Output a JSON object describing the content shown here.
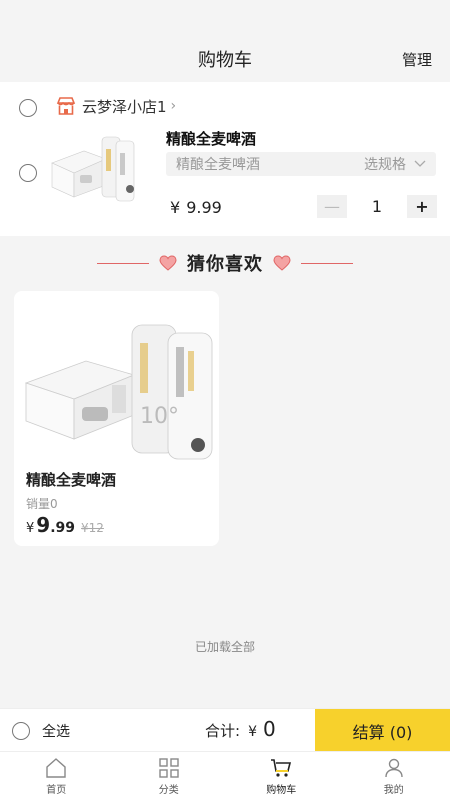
{
  "header": {
    "title": "购物车",
    "manage": "管理"
  },
  "cart": {
    "shop_name": "云梦泽小店1",
    "item": {
      "title": "精酿全麦啤酒",
      "spec": "精酿全麦啤酒",
      "spec_select": "选规格",
      "currency": "¥",
      "price": "9.99",
      "quantity": "1",
      "minus": "—",
      "plus": "+"
    }
  },
  "recommend": {
    "title": "猜你喜欢",
    "product": {
      "name": "精酿全麦啤酒",
      "sales": "销量0",
      "currency": "¥",
      "price_int": "9",
      "price_dec": ".99",
      "original_price": "¥12"
    }
  },
  "loaded_all": "已加载全部",
  "checkout": {
    "select_all": "全选",
    "total_label": "合计:",
    "currency": "¥",
    "total": "0",
    "pay_button": "结算 (0)"
  },
  "tabs": [
    {
      "label": "首页",
      "icon": "home-icon"
    },
    {
      "label": "分类",
      "icon": "grid-icon"
    },
    {
      "label": "购物车",
      "icon": "cart-icon"
    },
    {
      "label": "我的",
      "icon": "user-icon"
    }
  ],
  "colors": {
    "accent": "#f7d12c",
    "heart": "#e06666",
    "store": "#e86a4a"
  }
}
